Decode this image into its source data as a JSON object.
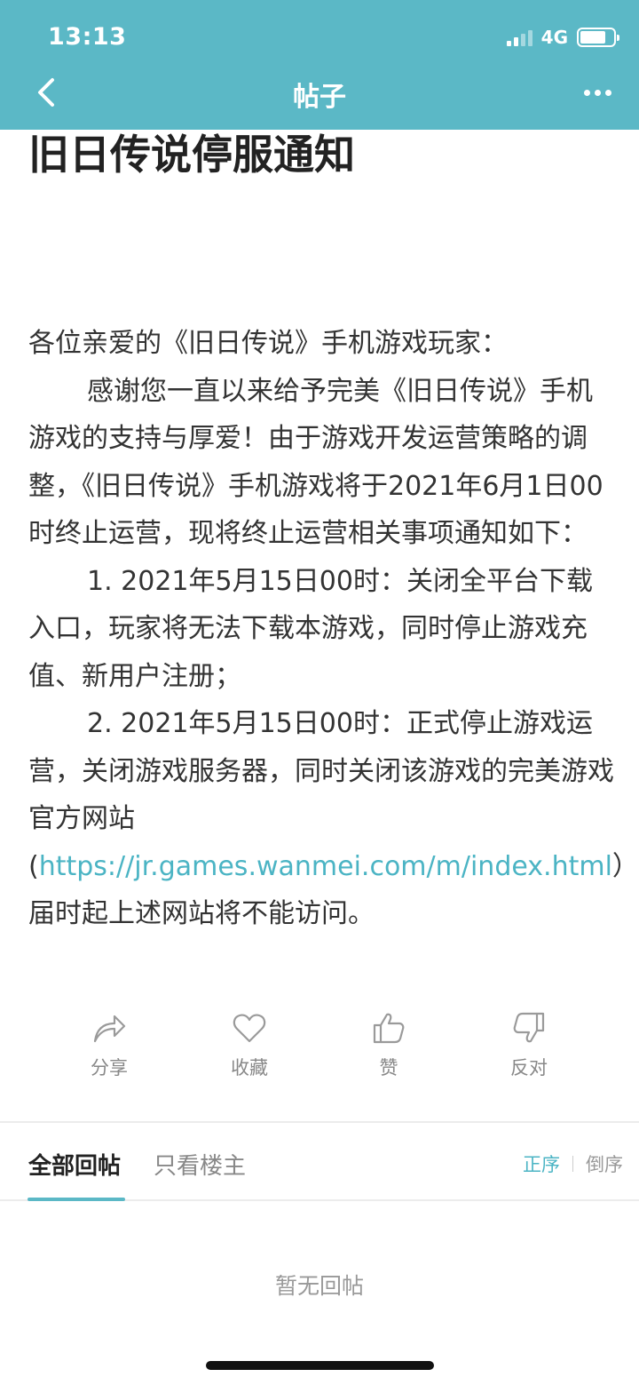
{
  "status_bar": {
    "time": "13:13",
    "network": "4G"
  },
  "nav": {
    "title": "帖子",
    "back_icon": "chevron-left-icon",
    "more_icon": "more-dots-icon"
  },
  "post": {
    "title": "旧日传说停服通知",
    "greeting": "各位亲爱的《旧日传说》手机游戏玩家：",
    "para1": "感谢您一直以来给予完美《旧日传说》手机游戏的支持与厚爱！由于游戏开发运营策略的调整，《旧日传说》手机游戏将于2021年6月1日00时终止运营，现将终止运营相关事项通知如下：",
    "item1": "1. 2021年5月15日00时：关闭全平台下载入口，玩家将无法下载本游戏，同时停止游戏充值、新用户注册；",
    "item2_before": "2. 2021年5月15日00时：正式停止游戏运营，关闭游戏服务器，同时关闭该游戏的完美游戏官方网站 (",
    "item2_link": "https://jr.games.wanmei.com/m/index.html",
    "item2_after": "）届时起上述网站将不能访问。"
  },
  "actions": {
    "share": "分享",
    "favorite": "收藏",
    "like": "赞",
    "dislike": "反对"
  },
  "replies": {
    "tab_all": "全部回帖",
    "tab_owner": "只看楼主",
    "sort_asc": "正序",
    "sort_desc": "倒序",
    "empty": "暂无回帖"
  },
  "colors": {
    "accent": "#5bb8c6",
    "link": "#4bb4c4"
  }
}
